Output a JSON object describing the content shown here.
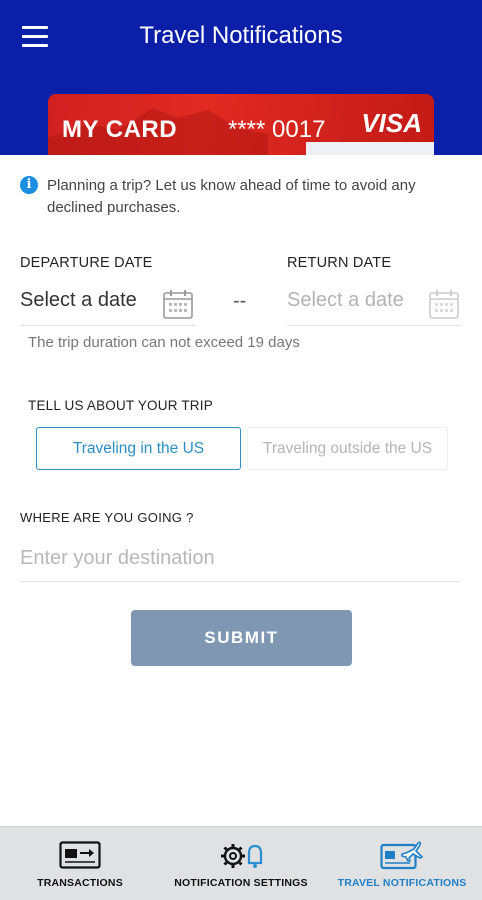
{
  "header": {
    "title": "Travel Notifications",
    "menu_icon": "hamburger-menu-icon"
  },
  "card": {
    "name": "MY CARD",
    "number": "**** 0017",
    "brand": "VISA",
    "color": "#d9241c"
  },
  "info": {
    "icon": "info-icon",
    "text": "Planning a trip? Let us know ahead of time to avoid any declined purchases."
  },
  "dates": {
    "departure_label": "DEPARTURE DATE",
    "departure_value": "Select a date",
    "separator": "--",
    "return_label": "RETURN DATE",
    "return_value": "Select a date",
    "calendar_icon": "calendar-icon",
    "hint": "The trip duration can not exceed 19 days"
  },
  "trip": {
    "label": "TELL US ABOUT YOUR TRIP",
    "options": [
      "Traveling in the US",
      "Traveling outside the US"
    ],
    "selected": "Traveling in the US"
  },
  "destination": {
    "label": "WHERE ARE YOU GOING ?",
    "placeholder": "Enter your destination",
    "value": ""
  },
  "submit_label": "SUBMIT",
  "bottom_nav": {
    "items": [
      {
        "label": "TRANSACTIONS",
        "icon": "transactions-card-icon"
      },
      {
        "label": "NOTIFICATION SETTINGS",
        "icon": "gear-bell-icon"
      },
      {
        "label": "TRAVEL NOTIFICATIONS",
        "icon": "card-airplane-icon"
      }
    ],
    "active": "TRAVEL NOTIFICATIONS"
  },
  "colors": {
    "header": "#0b1fa9",
    "accent": "#2b8fc6",
    "submit": "#7f97b2",
    "nav_bg": "#dfe1e3"
  }
}
